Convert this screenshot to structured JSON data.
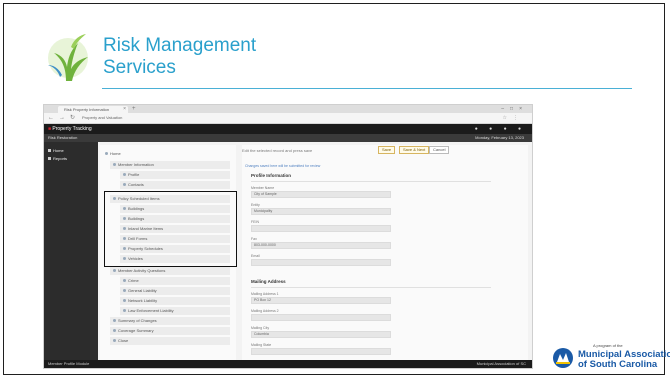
{
  "slide": {
    "title_line1": "Risk Management",
    "title_line2": "Services",
    "footer_note": "A program of the",
    "footer_org_line1": "Municipal Association",
    "footer_org_line2": "of South Carolina"
  },
  "browser": {
    "tab_label": "Risk Property Information",
    "url": "Property and Valuation",
    "new_tab": "+",
    "close": "×"
  },
  "app": {
    "brand": "Property Tracking",
    "subheader_left": "Risk Restoration",
    "subheader_right": "Monday, February 13, 2023",
    "sidebar": [
      {
        "label": "Home"
      },
      {
        "label": "Reports"
      }
    ],
    "tree": [
      {
        "label": "Home",
        "level": 0
      },
      {
        "label": "Member Information",
        "level": 1
      },
      {
        "label": "Profile",
        "level": 2
      },
      {
        "label": "Contacts",
        "level": 2
      },
      {
        "label": "Policy Scheduled Items",
        "level": 1
      },
      {
        "label": "Buildings",
        "level": 2
      },
      {
        "label": "Buildings",
        "level": 2
      },
      {
        "label": "Inland Marine Items",
        "level": 2
      },
      {
        "label": "Drill Forms",
        "level": 2
      },
      {
        "label": "Property Schedules",
        "level": 2
      },
      {
        "label": "Vehicles",
        "level": 2
      },
      {
        "label": "Member Activity Questions",
        "level": 1
      },
      {
        "label": "Crime",
        "level": 2
      },
      {
        "label": "General Liability",
        "level": 2
      },
      {
        "label": "Network Liability",
        "level": 2
      },
      {
        "label": "Law Enforcement Liability",
        "level": 2
      },
      {
        "label": "Summary of Changes",
        "level": 1
      },
      {
        "label": "Coverage Summary",
        "level": 1
      },
      {
        "label": "Close",
        "level": 1
      }
    ],
    "form": {
      "edit_note": "Edit the selected record and press save",
      "buttons": [
        "Save",
        "Save & Next",
        "Cancel"
      ],
      "link_note": "Changes saved here will be submitted for review",
      "profile_title": "Profile Information",
      "fields": [
        {
          "label": "Member Name",
          "value": "City of Sample"
        },
        {
          "label": "Entity",
          "value": "Municipality"
        },
        {
          "label": "FEIN",
          "value": ""
        },
        {
          "label": "Fax",
          "value": "803-000-0000"
        },
        {
          "label": "Email",
          "value": ""
        }
      ],
      "mailing_title": "Mailing Address",
      "mailing_fields": [
        {
          "label": "Mailing Address 1",
          "value": "PO Box 12"
        },
        {
          "label": "Mailing Address 2",
          "value": ""
        },
        {
          "label": "Mailing City",
          "value": "Columbia"
        },
        {
          "label": "Mailing State",
          "value": ""
        }
      ]
    },
    "status_left": "Member Profile Module",
    "status_right": "Municipal Association of SC"
  },
  "colors": {
    "title": "#2aa0cc",
    "rule": "#4ab0d6",
    "brand_red": "#cc1f2b",
    "masc_blue": "#1a5aa6"
  }
}
